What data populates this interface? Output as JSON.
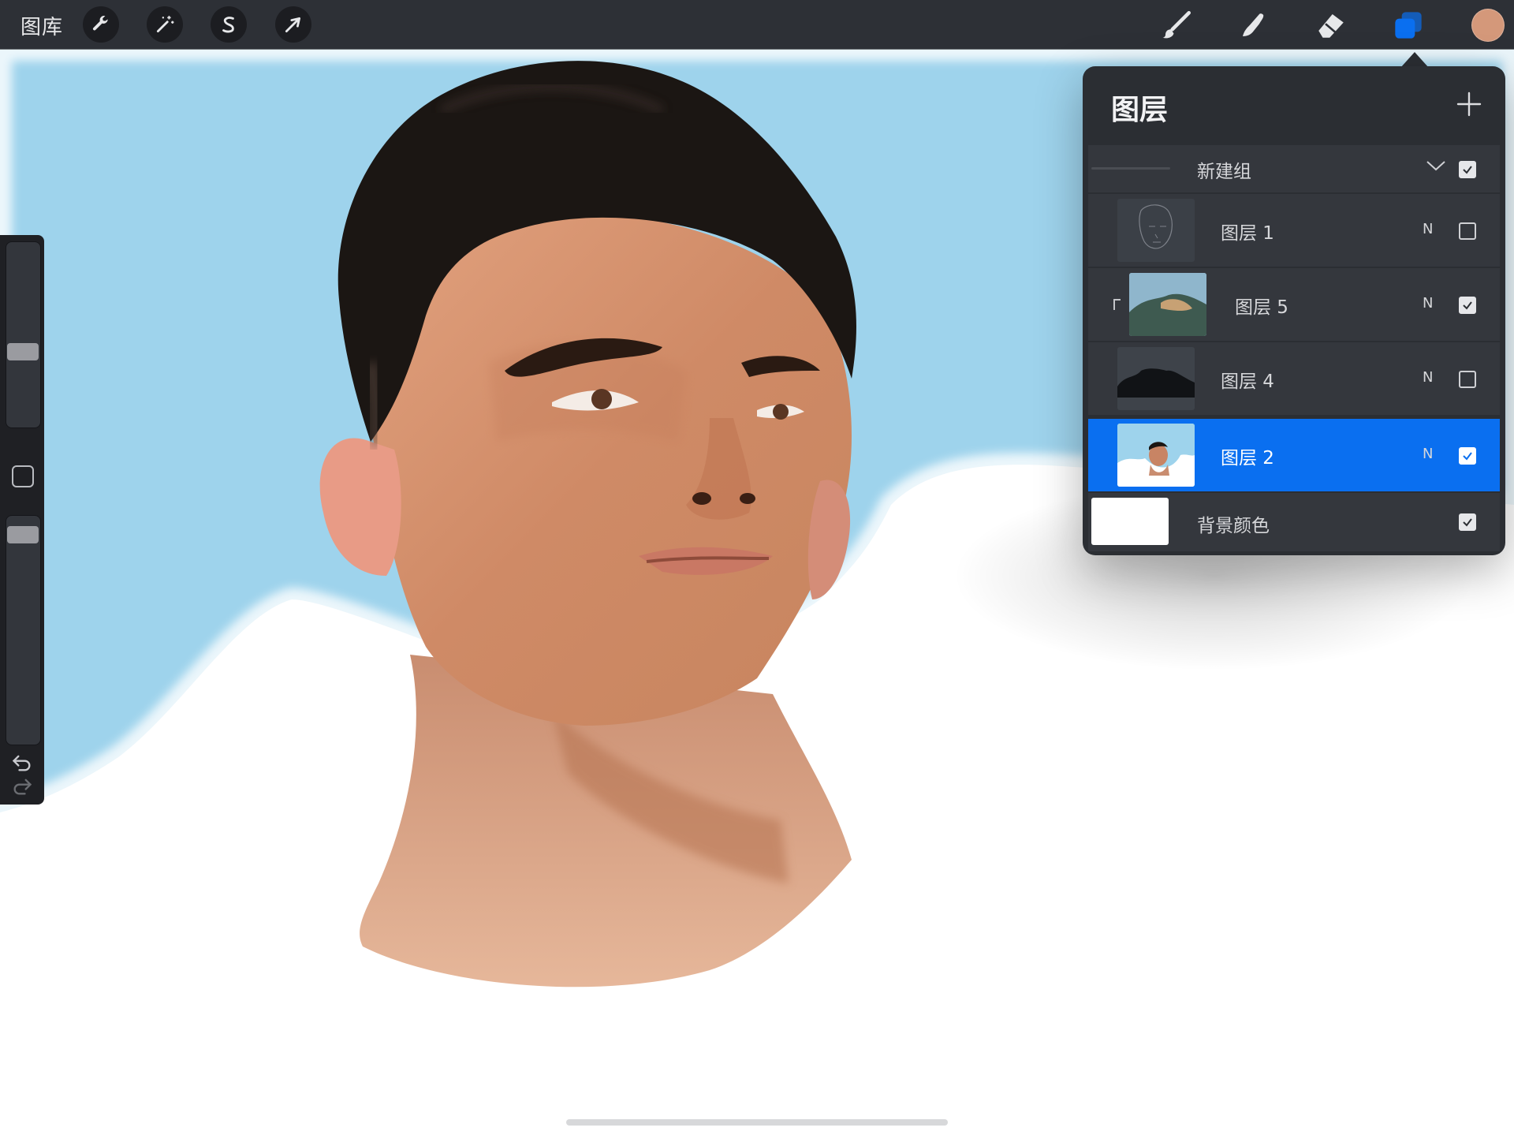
{
  "toolbar": {
    "gallery_label": "图库",
    "left_tools": [
      {
        "name": "actions",
        "icon": "wrench-icon"
      },
      {
        "name": "adjustments",
        "icon": "magic-wand-icon"
      },
      {
        "name": "selection",
        "icon": "selection-s-icon"
      },
      {
        "name": "transform",
        "icon": "arrow-cursor-icon"
      }
    ],
    "right_tools": [
      {
        "name": "brush",
        "icon": "brush-icon"
      },
      {
        "name": "smudge",
        "icon": "smudge-finger-icon"
      },
      {
        "name": "eraser",
        "icon": "eraser-icon"
      },
      {
        "name": "layers",
        "icon": "layers-icon",
        "active": true
      }
    ],
    "current_color": "#d4987a"
  },
  "sidebar": {
    "brush_size_level": 0.4,
    "opacity_level": 0.95,
    "modify_icon": "square-icon",
    "undo_icon": "undo-icon",
    "redo_icon": "redo-icon"
  },
  "layers_panel": {
    "title": "图层",
    "add_icon": "plus-icon",
    "group": {
      "name": "新建组",
      "visible": true,
      "expand_icon": "chevron-down-icon"
    },
    "layers": [
      {
        "name": "图层 1",
        "blend": "N",
        "visible": false,
        "selected": false,
        "clipped": false
      },
      {
        "name": "图层 5",
        "blend": "N",
        "visible": true,
        "selected": false,
        "clipped": true
      },
      {
        "name": "图层 4",
        "blend": "N",
        "visible": false,
        "selected": false,
        "clipped": false
      },
      {
        "name": "图层 2",
        "blend": "N",
        "visible": true,
        "selected": true,
        "clipped": false
      }
    ],
    "background": {
      "name": "背景颜色",
      "visible": true,
      "color": "#ffffff"
    }
  },
  "colors": {
    "sky": "#9ed3ec",
    "accent_blue": "#0a6ff0",
    "toolbar_bg": "#2d3036",
    "panel_bg": "#2b2e33"
  }
}
